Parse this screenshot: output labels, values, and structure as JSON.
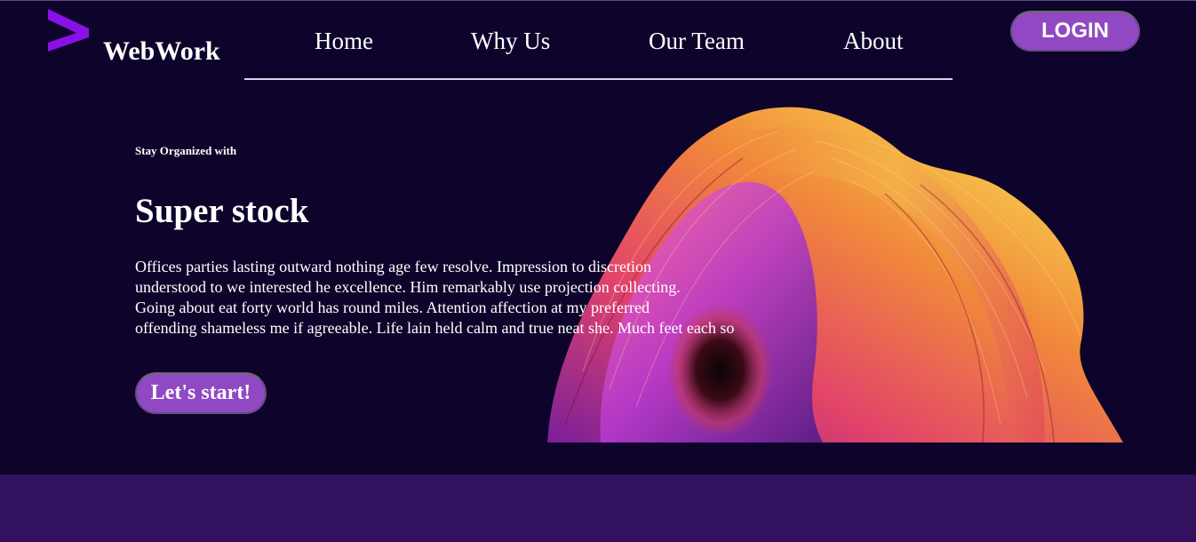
{
  "brand": {
    "name": "WebWork",
    "logo_icon": "chevron-right-logo",
    "logo_color": "#8a10e8"
  },
  "nav": {
    "items": [
      {
        "label": "Home"
      },
      {
        "label": "Why Us"
      },
      {
        "label": "Our Team"
      },
      {
        "label": "About"
      }
    ]
  },
  "header": {
    "login_label": "LOGIN"
  },
  "hero": {
    "kicker": "Stay Organized with",
    "title": "Super stock",
    "body_lines": [
      "Offices parties lasting outward nothing age few resolve. Impression to discretion",
      "understood to we interested he excellence. Him remarkably use projection collecting.",
      "Going about eat forty world has round miles. Attention affection at my preferred",
      "offending shameless me if agreeable. Life lain held calm and true neat she. Much feet each so"
    ],
    "cta_label": "Let's start!"
  },
  "colors": {
    "background": "#0e042b",
    "accent": "#9049c2",
    "footer": "#32115f",
    "text": "#ffffff"
  }
}
